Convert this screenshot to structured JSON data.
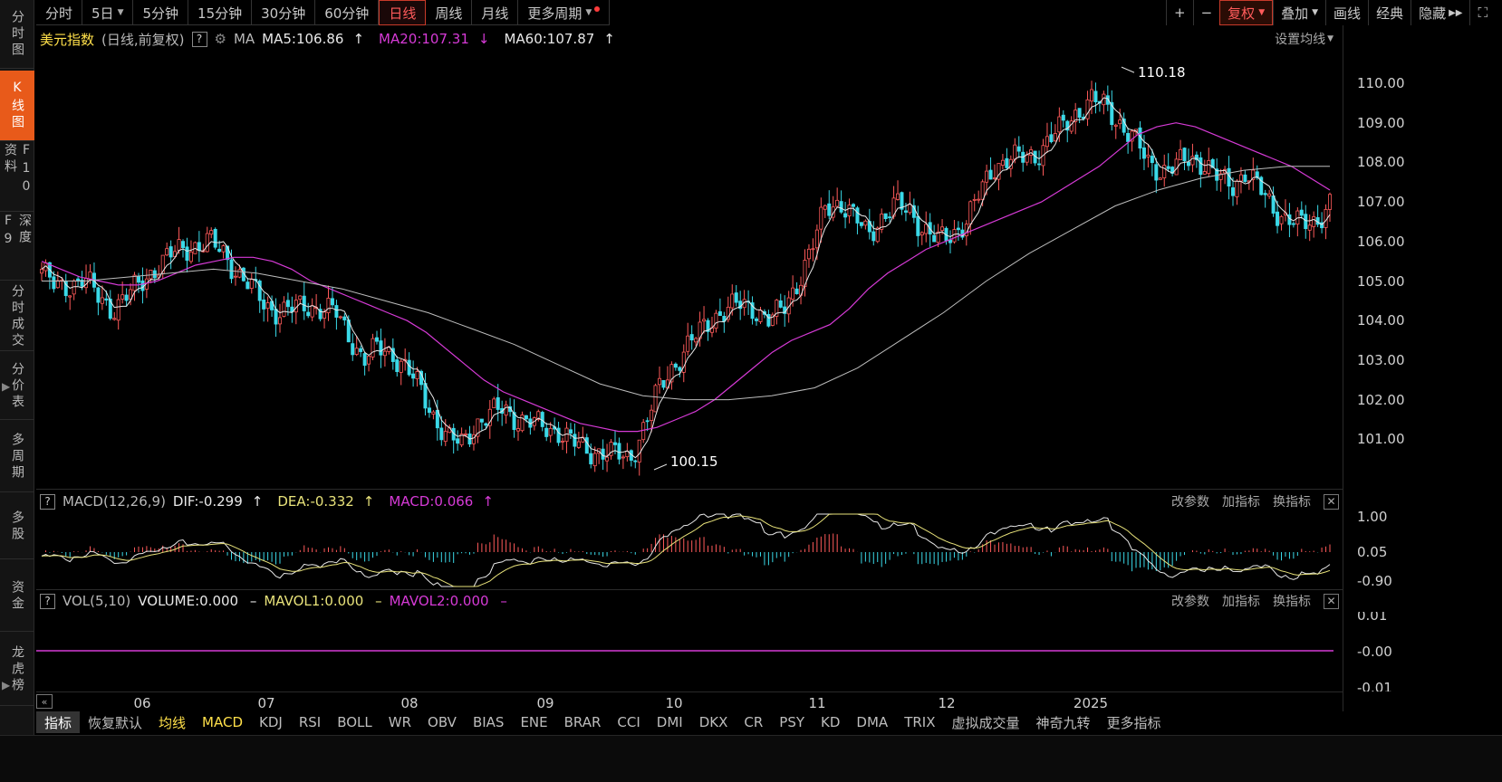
{
  "left_nav": [
    {
      "label": "分时图"
    },
    {
      "label": "K线图"
    },
    {
      "label": "F10资料"
    },
    {
      "label": "深度F9"
    },
    {
      "label": "分时成交"
    },
    {
      "label": "分价表"
    },
    {
      "label": "多周期"
    },
    {
      "label": "多股"
    },
    {
      "label": "资金"
    },
    {
      "label": "龙虎榜"
    }
  ],
  "period_tabs": [
    {
      "label": "分时"
    },
    {
      "label": "5日"
    },
    {
      "label": "5分钟"
    },
    {
      "label": "15分钟"
    },
    {
      "label": "30分钟"
    },
    {
      "label": "60分钟"
    },
    {
      "label": "日线"
    },
    {
      "label": "周线"
    },
    {
      "label": "月线"
    },
    {
      "label": "更多周期"
    }
  ],
  "right_toolbar": {
    "plus": "+",
    "minus": "−",
    "fuquan": "复权",
    "diejia": "叠加",
    "huaxian": "画线",
    "jingdian": "经典",
    "yincang": "隐藏",
    "expand": "⛶"
  },
  "main_chart": {
    "name": "美元指数",
    "mode": "(日线,前复权)",
    "ma_label": "MA",
    "ma5": "MA5:106.86",
    "ma20": "MA20:107.31",
    "ma60": "MA60:107.87",
    "settings": "设置均线",
    "high_label": "110.18",
    "low_label": "100.15"
  },
  "macd_panel": {
    "label": "MACD(12,26,9)",
    "dif": "DIF:-0.299",
    "dea": "DEA:-0.332",
    "macd": "MACD:0.066",
    "ticks": [
      "1.00",
      "0.05",
      "-0.90"
    ]
  },
  "vol_panel": {
    "label": "VOL(5,10)",
    "volume": "VOLUME:0.000",
    "mavol1": "MAVOL1:0.000",
    "mavol2": "MAVOL2:0.000",
    "ticks": [
      "0.01",
      "-0.00",
      "-0.01"
    ]
  },
  "panel_actions": {
    "params": "改参数",
    "add": "加指标",
    "swap": "换指标"
  },
  "time_axis": [
    "06",
    "07",
    "08",
    "09",
    "10",
    "11",
    "12",
    "2025"
  ],
  "indicator_tabs": [
    "指标",
    "恢复默认",
    "均线",
    "MACD",
    "KDJ",
    "RSI",
    "BOLL",
    "WR",
    "OBV",
    "BIAS",
    "ENE",
    "BRAR",
    "CCI",
    "DMI",
    "DKX",
    "CR",
    "PSY",
    "KD",
    "DMA",
    "TRIX",
    "虚拟成交量",
    "神奇九转",
    "更多指标"
  ],
  "colors": {
    "up": "#ff5a5a",
    "down": "#3ad9e8",
    "ma5": "#e8e8e8",
    "ma20": "#d63ad6",
    "ma60": "#bdbdbd",
    "dea": "#e8e27a",
    "accent": "#e85a1a"
  },
  "chart_data": {
    "type": "candlestick",
    "title": "美元指数",
    "ylim": [
      100,
      110.6
    ],
    "price_ticks": [
      "110.00",
      "109.00",
      "108.00",
      "107.00",
      "106.00",
      "105.00",
      "104.00",
      "103.00",
      "102.00",
      "101.00"
    ],
    "close_path": [
      105.3,
      104.8,
      104.9,
      105.1,
      104.6,
      104.3,
      104.6,
      104.9,
      105.3,
      105.6,
      105.8,
      105.9,
      106.0,
      105.7,
      105.2,
      104.8,
      104.4,
      104.2,
      104.3,
      104.4,
      104.3,
      104.2,
      103.6,
      103.0,
      103.3,
      103.2,
      102.8,
      102.3,
      101.6,
      101.0,
      100.9,
      101.4,
      101.6,
      101.8,
      101.5,
      101.4,
      101.3,
      101.2,
      100.9,
      100.7,
      100.7,
      100.6,
      100.5,
      101.3,
      102.2,
      102.8,
      103.3,
      103.7,
      104.1,
      104.3,
      104.4,
      104.3,
      104.0,
      104.3,
      105.0,
      105.8,
      106.9,
      107.0,
      106.6,
      106.2,
      106.6,
      106.9,
      106.8,
      106.3,
      106.0,
      106.2,
      106.5,
      107.2,
      107.9,
      108.1,
      108.1,
      108.2,
      108.6,
      108.9,
      109.3,
      109.6,
      109.4,
      109.0,
      108.6,
      108.0,
      107.8,
      107.9,
      108.1,
      108.0,
      107.6,
      107.4,
      107.8,
      107.3,
      106.8,
      106.6,
      106.4,
      106.5,
      107.0
    ],
    "ma20_path": [
      105.5,
      105.3,
      105.1,
      105.0,
      104.9,
      104.9,
      105.0,
      105.2,
      105.4,
      105.5,
      105.6,
      105.6,
      105.5,
      105.3,
      105.0,
      104.8,
      104.6,
      104.4,
      104.2,
      104.0,
      103.7,
      103.3,
      102.9,
      102.5,
      102.2,
      102.0,
      101.8,
      101.6,
      101.4,
      101.3,
      101.2,
      101.2,
      101.3,
      101.5,
      101.7,
      102.0,
      102.4,
      102.8,
      103.2,
      103.5,
      103.7,
      103.9,
      104.3,
      104.8,
      105.2,
      105.5,
      105.8,
      106.0,
      106.2,
      106.4,
      106.6,
      106.8,
      107.0,
      107.3,
      107.6,
      107.9,
      108.3,
      108.7,
      108.9,
      109.0,
      108.9,
      108.7,
      108.5,
      108.3,
      108.1,
      107.9,
      107.6,
      107.3
    ],
    "ma60_path": [
      105.0,
      105.0,
      105.1,
      105.2,
      105.3,
      105.2,
      105.0,
      104.8,
      104.5,
      104.2,
      103.8,
      103.4,
      102.9,
      102.4,
      102.1,
      102.0,
      102.0,
      102.1,
      102.3,
      102.8,
      103.5,
      104.2,
      105.0,
      105.7,
      106.3,
      106.9,
      107.3,
      107.6,
      107.8,
      107.9,
      107.9
    ],
    "macd": {
      "dif": -0.299,
      "dea": -0.332,
      "macd": 0.066
    }
  }
}
